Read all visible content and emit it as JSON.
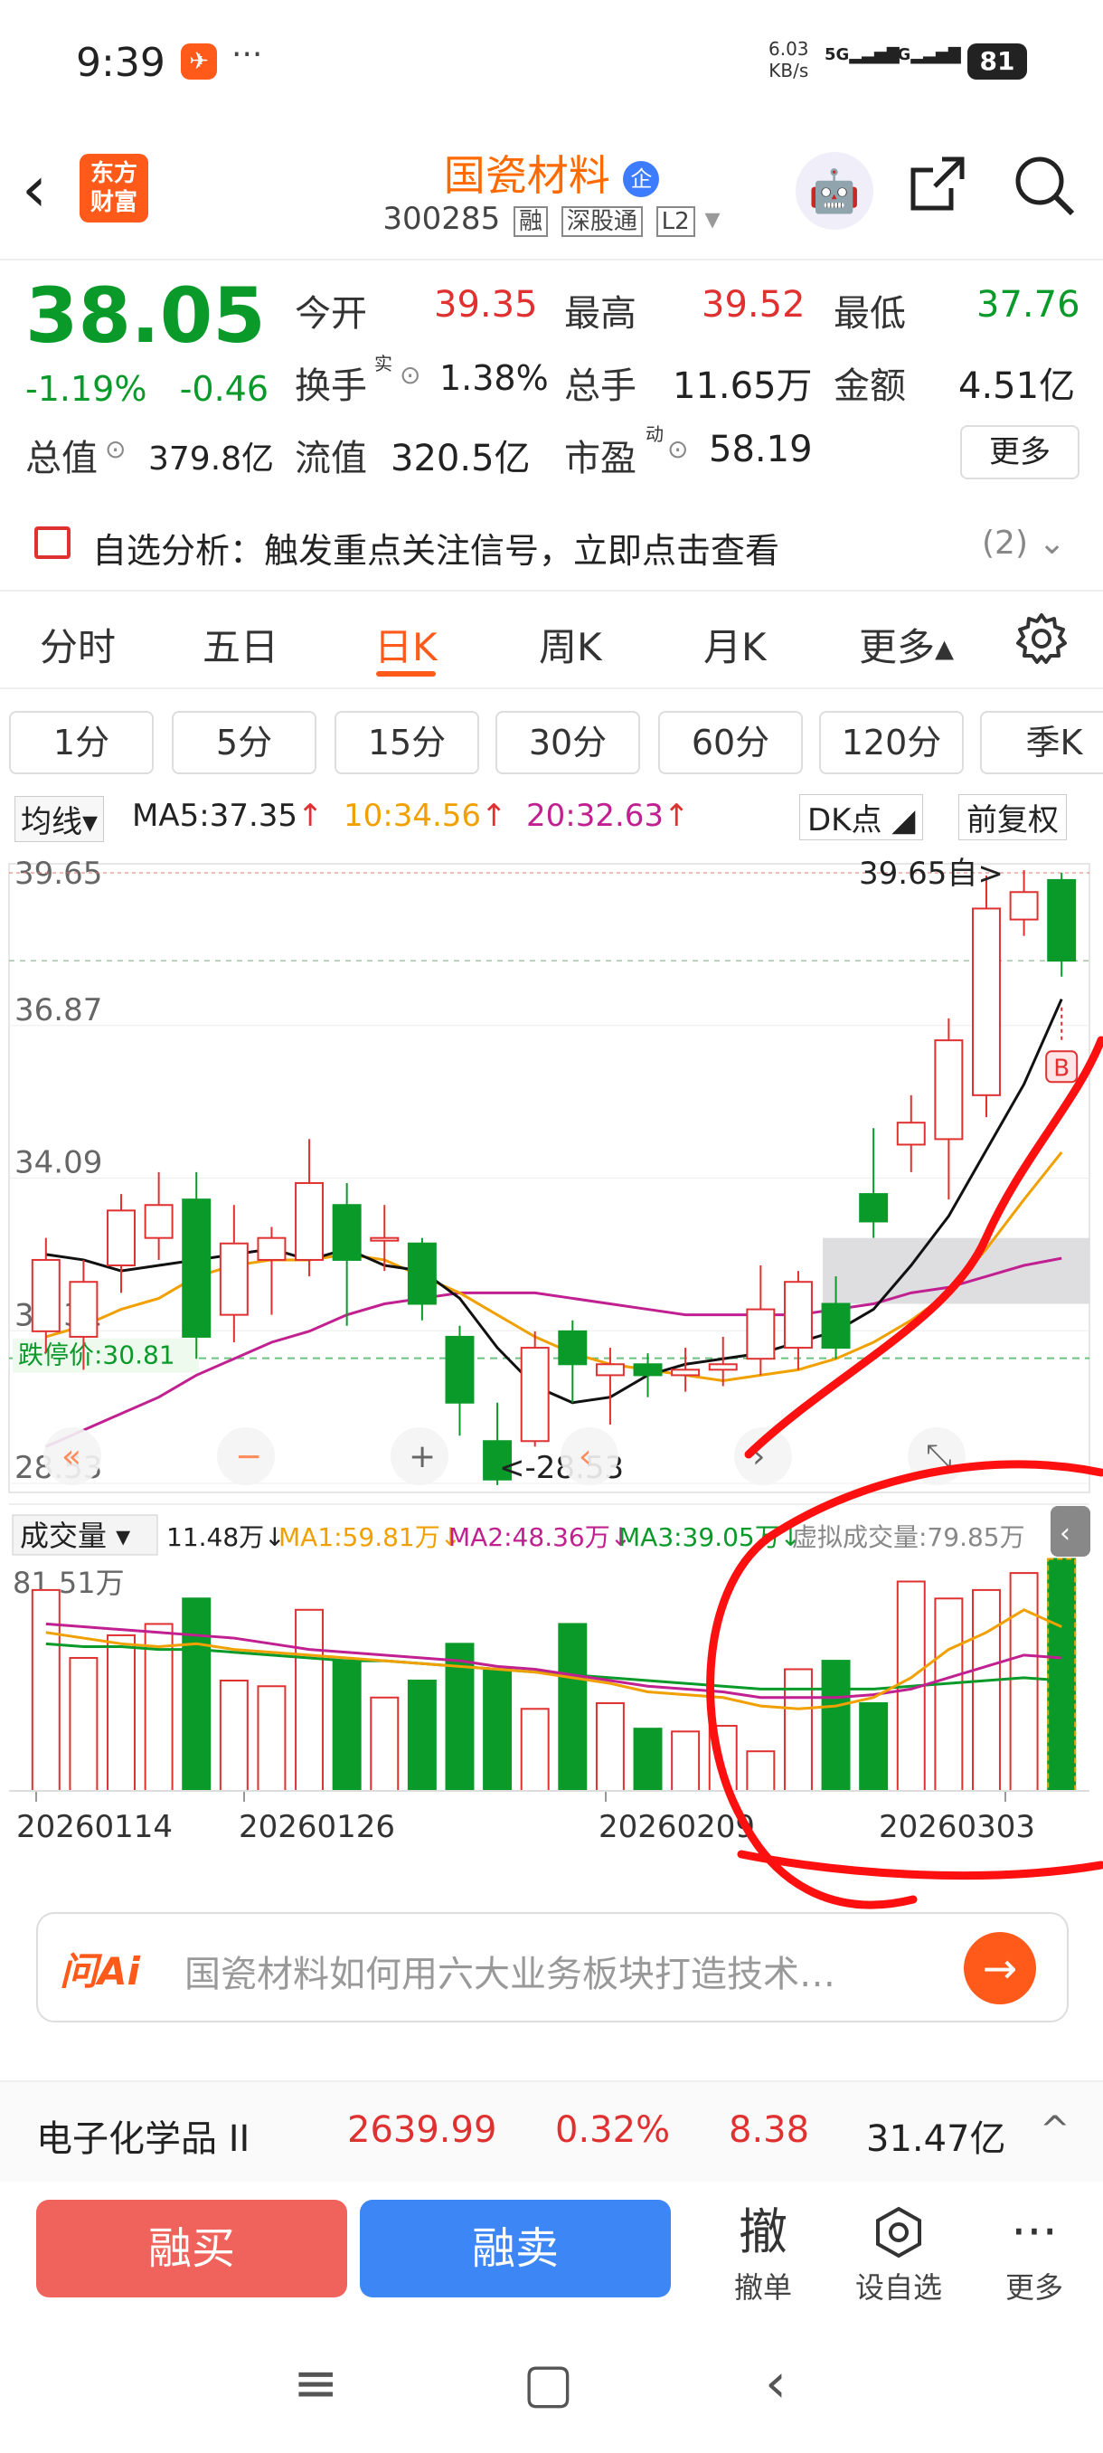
{
  "status": {
    "time": "9:39",
    "app_icon": "✈",
    "more": "···",
    "net_speed_value": "6.03",
    "net_speed_unit": "KB/s",
    "signal1": "5G",
    "signal2": "5G",
    "battery": "81"
  },
  "header": {
    "back_icon": "‹",
    "logo": "东方\n财富",
    "title": "国瓷材料",
    "title_badge": "企",
    "code": "300285",
    "tags": [
      "融",
      "深股通",
      "L2"
    ],
    "dropdown_icon": "▾",
    "share_icon": "share-icon",
    "search_icon": "search-icon"
  },
  "quote": {
    "price": "38.05",
    "change_pct": "-1.19%",
    "change": "-0.46",
    "open_label": "今开",
    "open": "39.35",
    "high_label": "最高",
    "high": "39.52",
    "low_label": "最低",
    "low": "37.76",
    "turnover_label": "换手",
    "turnover_sup": "实",
    "turnover": "1.38%",
    "volume_label": "总手",
    "volume": "11.65万",
    "amount_label": "金额",
    "amount": "4.51亿",
    "mktcap_label": "总值",
    "mktcap": "379.8亿",
    "float_label": "流值",
    "float": "320.5亿",
    "pe_label": "市盈",
    "pe_sup": "动",
    "pe": "58.19",
    "more": "更多"
  },
  "alert": {
    "text": "自选分析：触发重点关注信号，立即点击查看",
    "count": "(2)"
  },
  "tabs": [
    "分时",
    "五日",
    "日K",
    "周K",
    "月K",
    "更多▴"
  ],
  "active_tab": "日K",
  "periods": [
    "1分",
    "5分",
    "15分",
    "30分",
    "60分",
    "120分",
    "季K"
  ],
  "ma_bar": {
    "selector": "均线▾",
    "ma5": "MA5:37.35",
    "ma10": "10:34.56",
    "ma20": "20:32.63",
    "dk": "DK点",
    "fq": "前复权"
  },
  "chart_data": {
    "type": "candlestick",
    "y_ticks": [
      "39.65",
      "36.87",
      "34.09",
      "31.31",
      "28.53"
    ],
    "ylim": [
      28.53,
      39.65
    ],
    "limit_down_label": "跌停价:30.81",
    "high_marker": "39.65",
    "low_marker": "<-28.53",
    "buy_marker": "B",
    "candles": [
      {
        "o": 31.3,
        "c": 32.6,
        "h": 33.0,
        "l": 30.9
      },
      {
        "o": 31.2,
        "c": 32.2,
        "h": 32.6,
        "l": 30.6
      },
      {
        "o": 32.5,
        "c": 33.5,
        "h": 33.8,
        "l": 32.0
      },
      {
        "o": 33.0,
        "c": 33.6,
        "h": 34.2,
        "l": 32.6
      },
      {
        "o": 33.7,
        "c": 31.2,
        "h": 34.2,
        "l": 30.8
      },
      {
        "o": 31.6,
        "c": 32.9,
        "h": 33.6,
        "l": 31.1
      },
      {
        "o": 32.6,
        "c": 33.0,
        "h": 33.2,
        "l": 31.6
      },
      {
        "o": 32.6,
        "c": 34.0,
        "h": 34.8,
        "l": 32.3
      },
      {
        "o": 33.6,
        "c": 32.6,
        "h": 34.0,
        "l": 31.4
      },
      {
        "o": 33.0,
        "c": 33.0,
        "h": 33.6,
        "l": 32.4
      },
      {
        "o": 32.9,
        "c": 31.8,
        "h": 33.0,
        "l": 31.5
      },
      {
        "o": 31.2,
        "c": 30.0,
        "h": 31.4,
        "l": 29.4
      },
      {
        "o": 29.3,
        "c": 28.6,
        "h": 30.0,
        "l": 28.5
      },
      {
        "o": 29.3,
        "c": 31.0,
        "h": 31.3,
        "l": 29.2
      },
      {
        "o": 31.3,
        "c": 30.7,
        "h": 31.5,
        "l": 30.0
      },
      {
        "o": 30.5,
        "c": 30.7,
        "h": 31.0,
        "l": 29.6
      },
      {
        "o": 30.7,
        "c": 30.5,
        "h": 30.9,
        "l": 30.1
      },
      {
        "o": 30.5,
        "c": 30.6,
        "h": 31.0,
        "l": 30.2
      },
      {
        "o": 30.6,
        "c": 30.7,
        "h": 31.2,
        "l": 30.3
      },
      {
        "o": 30.8,
        "c": 31.7,
        "h": 32.5,
        "l": 30.5
      },
      {
        "o": 31.0,
        "c": 32.2,
        "h": 32.4,
        "l": 30.6
      },
      {
        "o": 31.8,
        "c": 31.0,
        "h": 32.3,
        "l": 30.8
      },
      {
        "o": 33.8,
        "c": 33.3,
        "h": 35.0,
        "l": 33.0
      },
      {
        "o": 34.7,
        "c": 35.1,
        "h": 35.6,
        "l": 34.2
      },
      {
        "o": 34.8,
        "c": 36.6,
        "h": 37.0,
        "l": 33.7
      },
      {
        "o": 35.6,
        "c": 39.0,
        "h": 39.6,
        "l": 35.2
      },
      {
        "o": 38.8,
        "c": 39.3,
        "h": 39.7,
        "l": 38.5
      },
      {
        "o": 39.52,
        "c": 38.05,
        "h": 39.65,
        "l": 37.76
      }
    ],
    "ma5": [
      32.7,
      32.6,
      32.4,
      32.5,
      32.6,
      32.7,
      32.8,
      32.6,
      32.8,
      32.5,
      32.4,
      31.9,
      31.0,
      30.3,
      30.0,
      30.1,
      30.5,
      30.7,
      30.8,
      30.9,
      31.1,
      31.3,
      31.7,
      32.5,
      33.4,
      34.6,
      35.8,
      37.35
    ],
    "ma10": [
      31.2,
      31.4,
      31.7,
      31.9,
      32.3,
      32.5,
      32.6,
      32.6,
      32.7,
      32.6,
      32.3,
      32.0,
      31.6,
      31.2,
      30.9,
      30.7,
      30.6,
      30.5,
      30.4,
      30.5,
      30.6,
      30.8,
      31.1,
      31.5,
      32.0,
      32.8,
      33.7,
      34.56
    ],
    "ma20": [
      29.2,
      29.5,
      29.8,
      30.1,
      30.5,
      30.8,
      31.1,
      31.3,
      31.6,
      31.8,
      31.9,
      32.0,
      32.0,
      32.0,
      31.9,
      31.8,
      31.7,
      31.6,
      31.6,
      31.6,
      31.6,
      31.7,
      31.8,
      32.0,
      32.1,
      32.3,
      32.5,
      32.63
    ],
    "volume": {
      "label": "成交量",
      "current": "11.48万",
      "ma1": "MA1:59.81万",
      "ma2": "MA2:48.36万",
      "ma3": "MA3:39.05万",
      "virtual": "虚拟成交量:79.85万",
      "max_label": "81.51万",
      "max": 81.51,
      "values": [
        71,
        47,
        55,
        59,
        68,
        39,
        37,
        64,
        46,
        33,
        39,
        52,
        43,
        29,
        59,
        31,
        22,
        21,
        23,
        14,
        43,
        46,
        31,
        74,
        68,
        71,
        77,
        82
      ],
      "ma_a": [
        56,
        54,
        52,
        51,
        52,
        50,
        49,
        48,
        47,
        46,
        45,
        44,
        43,
        42,
        40,
        38,
        35,
        34,
        33,
        30,
        29,
        30,
        33,
        40,
        50,
        56,
        64,
        58
      ],
      "ma_b": [
        59,
        58,
        57,
        56,
        55,
        54,
        52,
        50,
        49,
        48,
        47,
        46,
        44,
        43,
        41,
        39,
        37,
        36,
        35,
        33,
        33,
        33,
        34,
        36,
        40,
        44,
        48,
        47
      ],
      "ma_c": [
        52,
        51,
        51,
        50,
        50,
        49,
        48,
        47,
        46,
        46,
        45,
        44,
        43,
        42,
        41,
        40,
        39,
        38,
        37,
        36,
        36,
        36,
        36,
        37,
        38,
        39,
        40,
        39
      ]
    },
    "dates": [
      "20260114",
      "20260126",
      "20260209",
      "20260303"
    ]
  },
  "ai": {
    "logo": "问Ai",
    "prompt": "国瓷材料如何用六大业务板块打造技术…",
    "go_icon": "→"
  },
  "sector": {
    "name": "电子化学品 II",
    "index": "2639.99",
    "pct": "0.32%",
    "change": "8.38",
    "amount": "31.47亿",
    "arrow": "^"
  },
  "actions": {
    "buy": "融买",
    "sell": "融卖",
    "revoke_icon": "撤",
    "revoke": "撤单",
    "watch": "设自选",
    "more_icon": "···",
    "more": "更多"
  },
  "nav": {
    "menu": "≡",
    "home": "▢",
    "back": "‹"
  },
  "colors": {
    "up": "#e03131",
    "down": "#0a9a2a",
    "brand": "#ff5a1a",
    "sell_blue": "#3d86f5"
  }
}
